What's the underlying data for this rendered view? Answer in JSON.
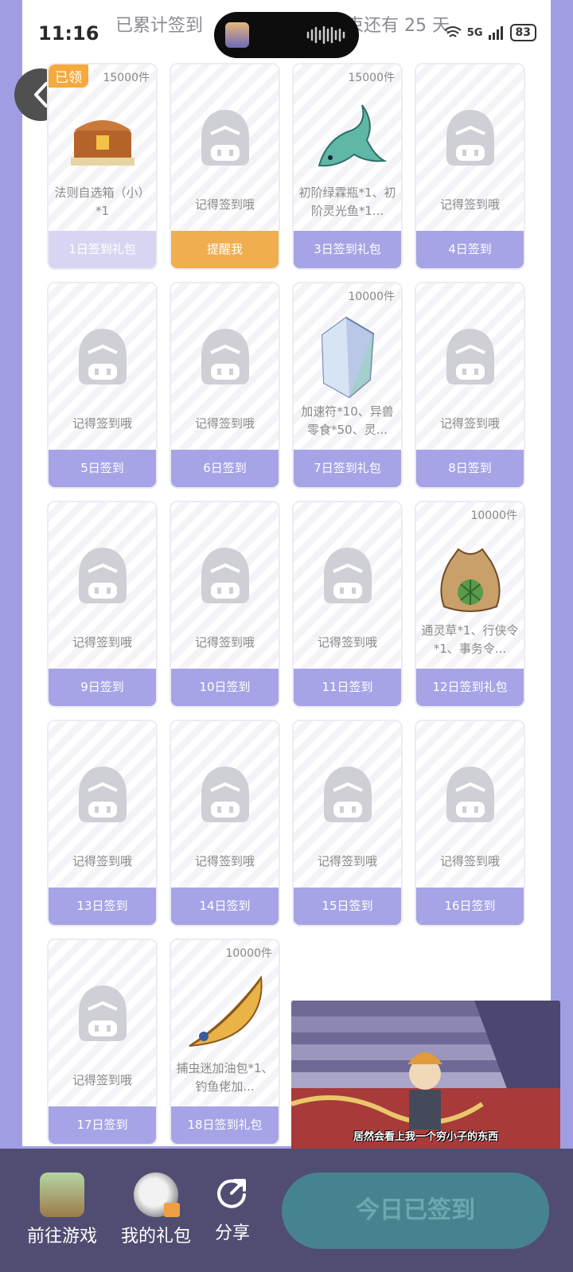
{
  "status_bar": {
    "time": "11:16",
    "network": "5G",
    "battery": "83"
  },
  "header": {
    "left_text": "已累计签到",
    "right_text": "束还有 25 天"
  },
  "back_icon": "chevron-left-icon",
  "cards": [
    {
      "day": "1日签到礼包",
      "count": "15000件",
      "desc": "法则自选箱（小）*1",
      "tag": "已领",
      "state": "claimed",
      "icon": "treasure-chest-icon"
    },
    {
      "day": "提醒我",
      "count": "",
      "desc": "记得签到哦",
      "tag": "",
      "state": "remind",
      "icon": "placeholder-avatar-icon"
    },
    {
      "day": "3日签到礼包",
      "count": "15000件",
      "desc": "初阶绿霖瓶*1、初阶灵光鱼*1...",
      "tag": "",
      "state": "normal",
      "icon": "spirit-fish-icon"
    },
    {
      "day": "4日签到",
      "count": "",
      "desc": "记得签到哦",
      "tag": "",
      "state": "normal",
      "icon": "placeholder-avatar-icon"
    },
    {
      "day": "5日签到",
      "count": "",
      "desc": "记得签到哦",
      "tag": "",
      "state": "normal",
      "icon": "placeholder-avatar-icon"
    },
    {
      "day": "6日签到",
      "count": "",
      "desc": "记得签到哦",
      "tag": "",
      "state": "normal",
      "icon": "placeholder-avatar-icon"
    },
    {
      "day": "7日签到礼包",
      "count": "10000件",
      "desc": "加速符*10、异兽零食*50、灵...",
      "tag": "",
      "state": "normal",
      "icon": "crystal-icon"
    },
    {
      "day": "8日签到",
      "count": "",
      "desc": "记得签到哦",
      "tag": "",
      "state": "normal",
      "icon": "placeholder-avatar-icon"
    },
    {
      "day": "9日签到",
      "count": "",
      "desc": "记得签到哦",
      "tag": "",
      "state": "normal",
      "icon": "placeholder-avatar-icon"
    },
    {
      "day": "10日签到",
      "count": "",
      "desc": "记得签到哦",
      "tag": "",
      "state": "normal",
      "icon": "placeholder-avatar-icon"
    },
    {
      "day": "11日签到",
      "count": "",
      "desc": "记得签到哦",
      "tag": "",
      "state": "normal",
      "icon": "placeholder-avatar-icon"
    },
    {
      "day": "12日签到礼包",
      "count": "10000件",
      "desc": "通灵草*1、行侠令*1、事务令...",
      "tag": "",
      "state": "normal",
      "icon": "seed-bag-icon"
    },
    {
      "day": "13日签到",
      "count": "",
      "desc": "记得签到哦",
      "tag": "",
      "state": "normal",
      "icon": "placeholder-avatar-icon"
    },
    {
      "day": "14日签到",
      "count": "",
      "desc": "记得签到哦",
      "tag": "",
      "state": "normal",
      "icon": "placeholder-avatar-icon"
    },
    {
      "day": "15日签到",
      "count": "",
      "desc": "记得签到哦",
      "tag": "",
      "state": "normal",
      "icon": "placeholder-avatar-icon"
    },
    {
      "day": "16日签到",
      "count": "",
      "desc": "记得签到哦",
      "tag": "",
      "state": "normal",
      "icon": "placeholder-avatar-icon"
    },
    {
      "day": "17日签到",
      "count": "",
      "desc": "记得签到哦",
      "tag": "",
      "state": "normal",
      "icon": "placeholder-avatar-icon"
    },
    {
      "day": "18日签到礼包",
      "count": "10000件",
      "desc": "捕虫迷加油包*1、钓鱼佬加...",
      "tag": "",
      "state": "normal",
      "icon": "golden-feather-icon"
    }
  ],
  "video": {
    "caption": "居然会看上我一个穷小子的东西"
  },
  "bottom_bar": {
    "go_game": "前往游戏",
    "my_gifts": "我的礼包",
    "share": "分享",
    "signed_button": "今日已签到"
  }
}
